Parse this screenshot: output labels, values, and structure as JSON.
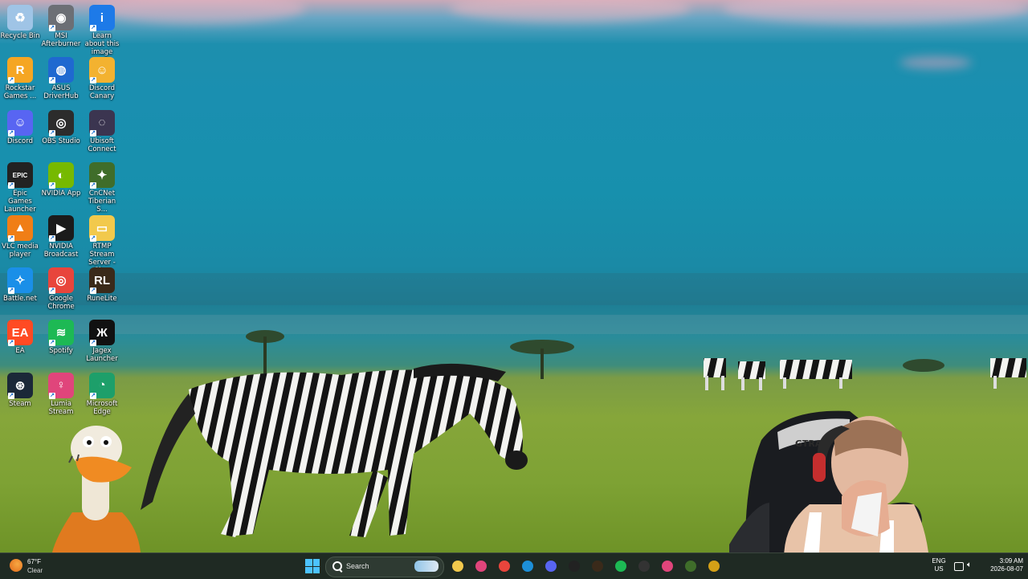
{
  "desktop_icons": [
    {
      "label": "Recycle Bin",
      "glyph": "♻",
      "color": "#9fc4e6",
      "icon": "recycle-bin-icon"
    },
    {
      "label": "MSI Afterburner",
      "glyph": "◉",
      "color": "#6c6f75",
      "icon": "msi-afterburner-icon"
    },
    {
      "label": "Learn about this image",
      "glyph": "i",
      "color": "#1d7ae8",
      "icon": "info-icon"
    },
    {
      "label": "Rockstar Games ...",
      "glyph": "R",
      "color": "#f5a623",
      "icon": "rockstar-icon"
    },
    {
      "label": "ASUS DriverHub",
      "glyph": "◍",
      "color": "#1f69d0",
      "icon": "asus-driverhub-icon"
    },
    {
      "label": "Discord Canary",
      "glyph": "☺",
      "color": "#f3b230",
      "icon": "discord-canary-icon"
    },
    {
      "label": "Discord",
      "glyph": "☺",
      "color": "#5865f2",
      "icon": "discord-icon"
    },
    {
      "label": "OBS Studio",
      "glyph": "◎",
      "color": "#2c2c2c",
      "icon": "obs-icon"
    },
    {
      "label": "Ubisoft Connect",
      "glyph": "◌",
      "color": "#3b3550",
      "icon": "ubisoft-icon"
    },
    {
      "label": "Epic Games Launcher",
      "glyph": "EPIC",
      "color": "#222222",
      "icon": "epic-games-icon"
    },
    {
      "label": "NVIDIA App",
      "glyph": "◐",
      "color": "#76b900",
      "icon": "nvidia-app-icon"
    },
    {
      "label": "CnCNet Tiberian S...",
      "glyph": "✦",
      "color": "#3f6d2a",
      "icon": "cncnet-icon"
    },
    {
      "label": "VLC media player",
      "glyph": "▲",
      "color": "#f07e16",
      "icon": "vlc-icon"
    },
    {
      "label": "NVIDIA Broadcast",
      "glyph": "▶",
      "color": "#1b1b1b",
      "icon": "nvidia-broadcast-icon"
    },
    {
      "label": "RTMP Stream Server - Sh...",
      "glyph": "▭",
      "color": "#f2c94c",
      "icon": "folder-icon"
    },
    {
      "label": "Battle.net",
      "glyph": "✧",
      "color": "#1a8fe8",
      "icon": "battlenet-icon"
    },
    {
      "label": "Google Chrome",
      "glyph": "◎",
      "color": "#e8453c",
      "icon": "chrome-icon"
    },
    {
      "label": "RuneLite",
      "glyph": "RL",
      "color": "#3a2a1a",
      "icon": "runelite-icon"
    },
    {
      "label": "EA",
      "glyph": "EA",
      "color": "#ff4a23",
      "icon": "ea-icon"
    },
    {
      "label": "Spotify",
      "glyph": "≋",
      "color": "#1db954",
      "icon": "spotify-icon"
    },
    {
      "label": "Jagex Launcher",
      "glyph": "Ж",
      "color": "#111111",
      "icon": "jagex-icon"
    },
    {
      "label": "Steam",
      "glyph": "⊛",
      "color": "#1b2838",
      "icon": "steam-icon"
    },
    {
      "label": "Lumia Stream",
      "glyph": "♀",
      "color": "#e0457b",
      "icon": "lumia-stream-icon"
    },
    {
      "label": "Microsoft Edge",
      "glyph": "◔",
      "color": "#1d9f6a",
      "icon": "edge-icon"
    }
  ],
  "taskbar": {
    "weather_temp": "67°F",
    "weather_cond": "Clear",
    "search_placeholder": "Search",
    "pinned": [
      {
        "name": "taskbar-file-explorer",
        "icon": "file-explorer-icon",
        "color": "#f2c94c"
      },
      {
        "name": "taskbar-lumia",
        "icon": "lumia-stream-icon",
        "color": "#e0457b"
      },
      {
        "name": "taskbar-chrome",
        "icon": "chrome-icon",
        "color": "#e8453c"
      },
      {
        "name": "taskbar-edge",
        "icon": "edge-icon",
        "color": "#1d8fd8"
      },
      {
        "name": "taskbar-discord",
        "icon": "discord-icon",
        "color": "#5865f2"
      },
      {
        "name": "taskbar-jagex",
        "icon": "jagex-icon",
        "color": "#222222"
      },
      {
        "name": "taskbar-runelite",
        "icon": "runelite-icon",
        "color": "#3a2a1a"
      },
      {
        "name": "taskbar-spotify",
        "icon": "spotify-icon",
        "color": "#1db954"
      },
      {
        "name": "taskbar-obs",
        "icon": "obs-icon",
        "color": "#333333"
      },
      {
        "name": "taskbar-lumia-2",
        "icon": "lumia-stream-icon",
        "color": "#e0457b"
      },
      {
        "name": "taskbar-cncnet",
        "icon": "cncnet-icon",
        "color": "#3f6d2a"
      },
      {
        "name": "taskbar-app",
        "icon": "app-icon",
        "color": "#d4a017"
      }
    ],
    "lang_1": "ENG",
    "lang_2": "US",
    "time": "3:09 AM",
    "date": "2026-08-07"
  },
  "webcam": {
    "chair_text": "GTRA"
  }
}
